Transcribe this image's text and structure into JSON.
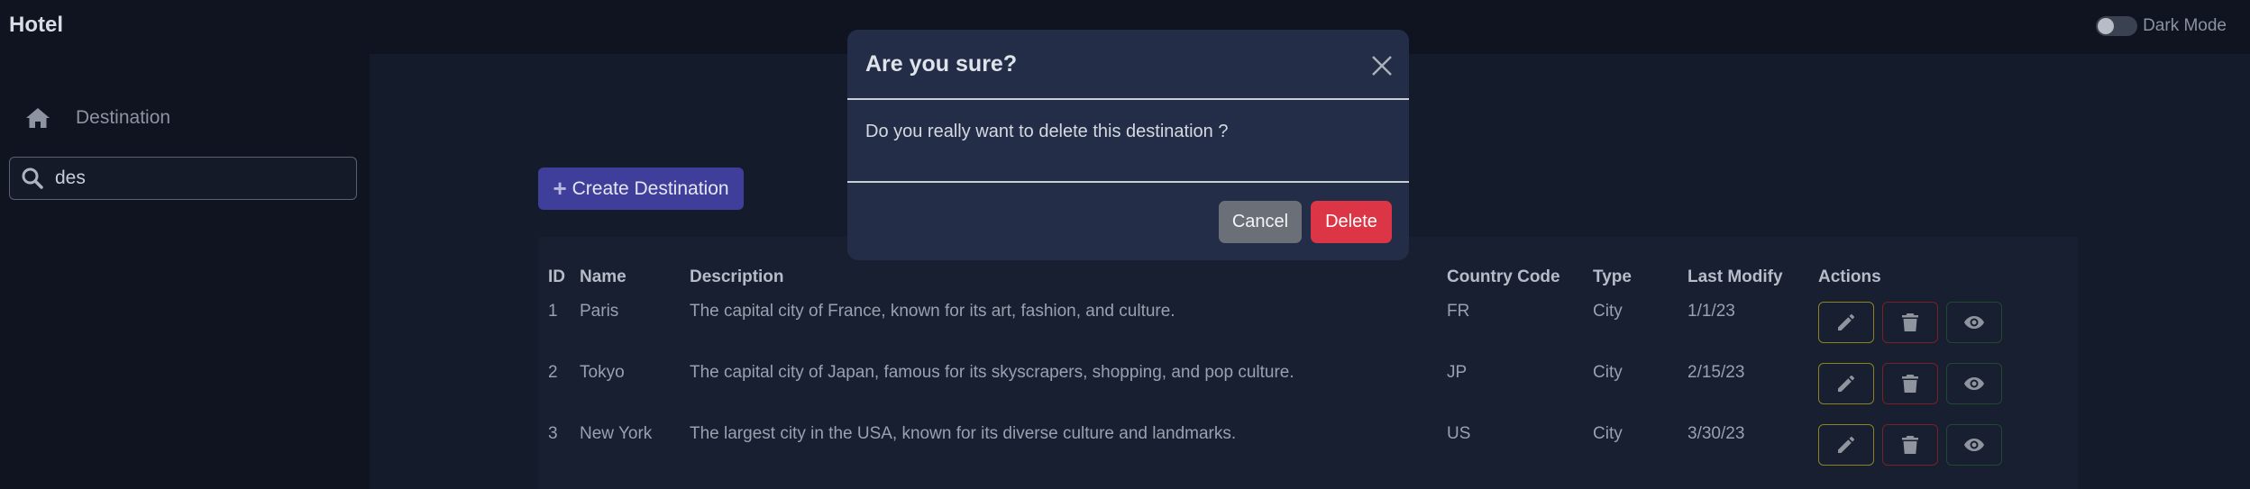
{
  "app": {
    "brand": "Hotel",
    "dark_mode_label": "Dark Mode"
  },
  "sidebar": {
    "items": [
      {
        "label": "Destination",
        "icon": "home-icon"
      }
    ],
    "search": {
      "value": "des",
      "icon": "search-icon"
    }
  },
  "main": {
    "create_button_label": "Create Destination",
    "table": {
      "columns": [
        "ID",
        "Name",
        "Description",
        "Country Code",
        "Type",
        "Last Modify",
        "Actions"
      ],
      "rows": [
        {
          "id": "1",
          "name": "Paris",
          "description": "The capital city of France, known for its art, fashion, and culture.",
          "country_code": "FR",
          "type": "City",
          "last_modify": "1/1/23"
        },
        {
          "id": "2",
          "name": "Tokyo",
          "description": "The capital city of Japan, famous for its skyscrapers, shopping, and pop culture.",
          "country_code": "JP",
          "type": "City",
          "last_modify": "2/15/23"
        },
        {
          "id": "3",
          "name": "New York",
          "description": "The largest city in the USA, known for its diverse culture and landmarks.",
          "country_code": "US",
          "type": "City",
          "last_modify": "3/30/23"
        }
      ],
      "action_icons": [
        "pencil-icon",
        "trash-icon",
        "eye-icon"
      ]
    }
  },
  "modal": {
    "title": "Are you sure?",
    "body": "Do you really want to delete this destination ?",
    "cancel_label": "Cancel",
    "delete_label": "Delete"
  },
  "colors": {
    "background": "#0f1420",
    "main_panel": "#141b2b",
    "modal": "#232d47",
    "primary": "#3f3e9a",
    "danger": "#dc3545",
    "secondary": "#6b7078",
    "edit_outline": "#8a8520",
    "delete_outline": "#7a2028",
    "view_outline": "#1f4a30"
  }
}
